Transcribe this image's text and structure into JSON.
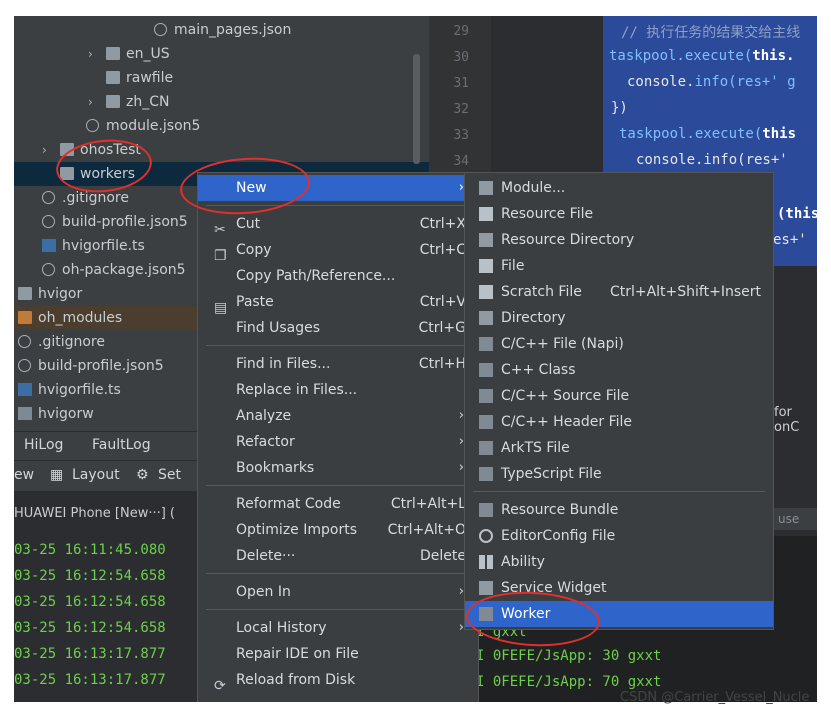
{
  "tree": [
    {
      "label": "main_pages.json",
      "type": "json",
      "indent": 140,
      "arrow": false
    },
    {
      "label": "en_US",
      "type": "folder",
      "indent": 92,
      "arrow": true
    },
    {
      "label": "rawfile",
      "type": "folder",
      "indent": 92,
      "arrow": false
    },
    {
      "label": "zh_CN",
      "type": "folder",
      "indent": 92,
      "arrow": true
    },
    {
      "label": "module.json5",
      "type": "json",
      "indent": 72,
      "arrow": false
    },
    {
      "label": "ohosTest",
      "type": "folder",
      "indent": 46,
      "arrow": true
    },
    {
      "label": "workers",
      "type": "folder",
      "indent": 46,
      "arrow": false,
      "selected": true
    },
    {
      "label": ".gitignore",
      "type": "json",
      "indent": 28,
      "arrow": false
    },
    {
      "label": "build-profile.json5",
      "type": "json",
      "indent": 28,
      "arrow": false
    },
    {
      "label": "hvigorfile.ts",
      "type": "ts",
      "indent": 28,
      "arrow": false
    },
    {
      "label": "oh-package.json5",
      "type": "json",
      "indent": 28,
      "arrow": false
    },
    {
      "label": "hvigor",
      "type": "folder",
      "indent": 4,
      "arrow": false
    },
    {
      "label": "oh_modules",
      "type": "folder-o",
      "indent": 4,
      "arrow": false,
      "selected2": true
    },
    {
      "label": ".gitignore",
      "type": "json",
      "indent": 4,
      "arrow": false
    },
    {
      "label": "build-profile.json5",
      "type": "json",
      "indent": 4,
      "arrow": false
    },
    {
      "label": "hvigorfile.ts",
      "type": "ts",
      "indent": 4,
      "arrow": false
    },
    {
      "label": "hvigorw",
      "type": "bat",
      "indent": 4,
      "arrow": false
    }
  ],
  "gutter_lines": [
    "29",
    "30",
    "31",
    "32",
    "33",
    "34"
  ],
  "code": {
    "comment": "//  执行任务的结果交给主线",
    "line1_fn": "taskpool.execute(",
    "line1_kw": "this.",
    "line2_a": "console.",
    "line2_b": "info(res+' g",
    "line3": "})",
    "line4_fn": "taskpool.execute(",
    "line4_kw": "this",
    "line5": "console.info(res+'",
    "line6_kw": "(this",
    "line7": "es+'"
  },
  "editor_hint": "for onC",
  "log_tabs": {
    "hilog": "HiLog",
    "faultlog": "FaultLog"
  },
  "log_toolbar": {
    "view": "ew",
    "layout": "Layout",
    "settings": "Set"
  },
  "log_device": "HUAWEI Phone [New···] (",
  "search_placeholder": "use",
  "log_lines": [
    "03-25 16:11:45.080",
    "03-25 16:12:54.658",
    "03-25 16:12:54.658",
    "03-25 16:12:54.658",
    "03-25 16:13:17.877",
    "03-25 16:13:17.877"
  ],
  "log_right": [
    "I 0FEFE/JsApp: 30 gxxt",
    "I 0FEFE/JsApp: 70 gxxt"
  ],
  "log_right_partial": "I gxxt",
  "menu": [
    {
      "label": "New",
      "shortcut": "",
      "submenu": true,
      "active": true,
      "icon": ""
    },
    {
      "label": "Cut",
      "shortcut": "Ctrl+X",
      "icon": "✂"
    },
    {
      "label": "Copy",
      "shortcut": "Ctrl+C",
      "icon": "❐"
    },
    {
      "label": "Copy Path/Reference...",
      "shortcut": "",
      "icon": ""
    },
    {
      "label": "Paste",
      "shortcut": "Ctrl+V",
      "icon": "▤"
    },
    {
      "label": "Find Usages",
      "shortcut": "Ctrl+G",
      "icon": ""
    },
    {
      "label": "Find in Files...",
      "shortcut": "Ctrl+H",
      "icon": ""
    },
    {
      "label": "Replace in Files...",
      "shortcut": "",
      "icon": ""
    },
    {
      "label": "Analyze",
      "shortcut": "",
      "submenu": true,
      "icon": ""
    },
    {
      "label": "Refactor",
      "shortcut": "",
      "submenu": true,
      "icon": ""
    },
    {
      "label": "Bookmarks",
      "shortcut": "",
      "submenu": true,
      "icon": ""
    },
    {
      "label": "Reformat Code",
      "shortcut": "Ctrl+Alt+L",
      "icon": ""
    },
    {
      "label": "Optimize Imports",
      "shortcut": "Ctrl+Alt+O",
      "icon": ""
    },
    {
      "label": "Delete···",
      "shortcut": "Delete",
      "icon": ""
    },
    {
      "label": "Open In",
      "shortcut": "",
      "submenu": true,
      "icon": ""
    },
    {
      "label": "Local History",
      "shortcut": "",
      "submenu": true,
      "icon": ""
    },
    {
      "label": "Repair IDE on File",
      "shortcut": "",
      "icon": ""
    },
    {
      "label": "Reload from Disk",
      "shortcut": "",
      "icon": "⟳"
    }
  ],
  "submenu": [
    {
      "label": "Module...",
      "shortcut": "",
      "icon": "folder"
    },
    {
      "label": "Resource File",
      "shortcut": "",
      "icon": "file"
    },
    {
      "label": "Resource Directory",
      "shortcut": "",
      "icon": "folder"
    },
    {
      "label": "File",
      "shortcut": "",
      "icon": "file"
    },
    {
      "label": "Scratch File",
      "shortcut": "Ctrl+Alt+Shift+Insert",
      "icon": "file"
    },
    {
      "label": "Directory",
      "shortcut": "",
      "icon": "folder"
    },
    {
      "label": "C/C++ File (Napi)",
      "shortcut": "",
      "icon": "code"
    },
    {
      "label": "C++ Class",
      "shortcut": "",
      "icon": "code"
    },
    {
      "label": "C/C++ Source File",
      "shortcut": "",
      "icon": "code"
    },
    {
      "label": "C/C++ Header File",
      "shortcut": "",
      "icon": "code"
    },
    {
      "label": "ArkTS File",
      "shortcut": "",
      "icon": "code"
    },
    {
      "label": "TypeScript File",
      "shortcut": "",
      "icon": "code"
    },
    {
      "label": "Resource Bundle",
      "shortcut": "",
      "icon": "code"
    },
    {
      "label": "EditorConfig File",
      "shortcut": "",
      "icon": "gear"
    },
    {
      "label": "Ability",
      "shortcut": "",
      "icon": "grid"
    },
    {
      "label": "Service Widget",
      "shortcut": "",
      "icon": "folder"
    },
    {
      "label": "Worker",
      "shortcut": "",
      "icon": "code",
      "active": true
    }
  ],
  "watermark": "CSDN @Carrier_Vessel_Nucle",
  "colors": {
    "accent": "#2f65ca",
    "annotation": "#e0302b",
    "log_green": "#6dd04a"
  }
}
